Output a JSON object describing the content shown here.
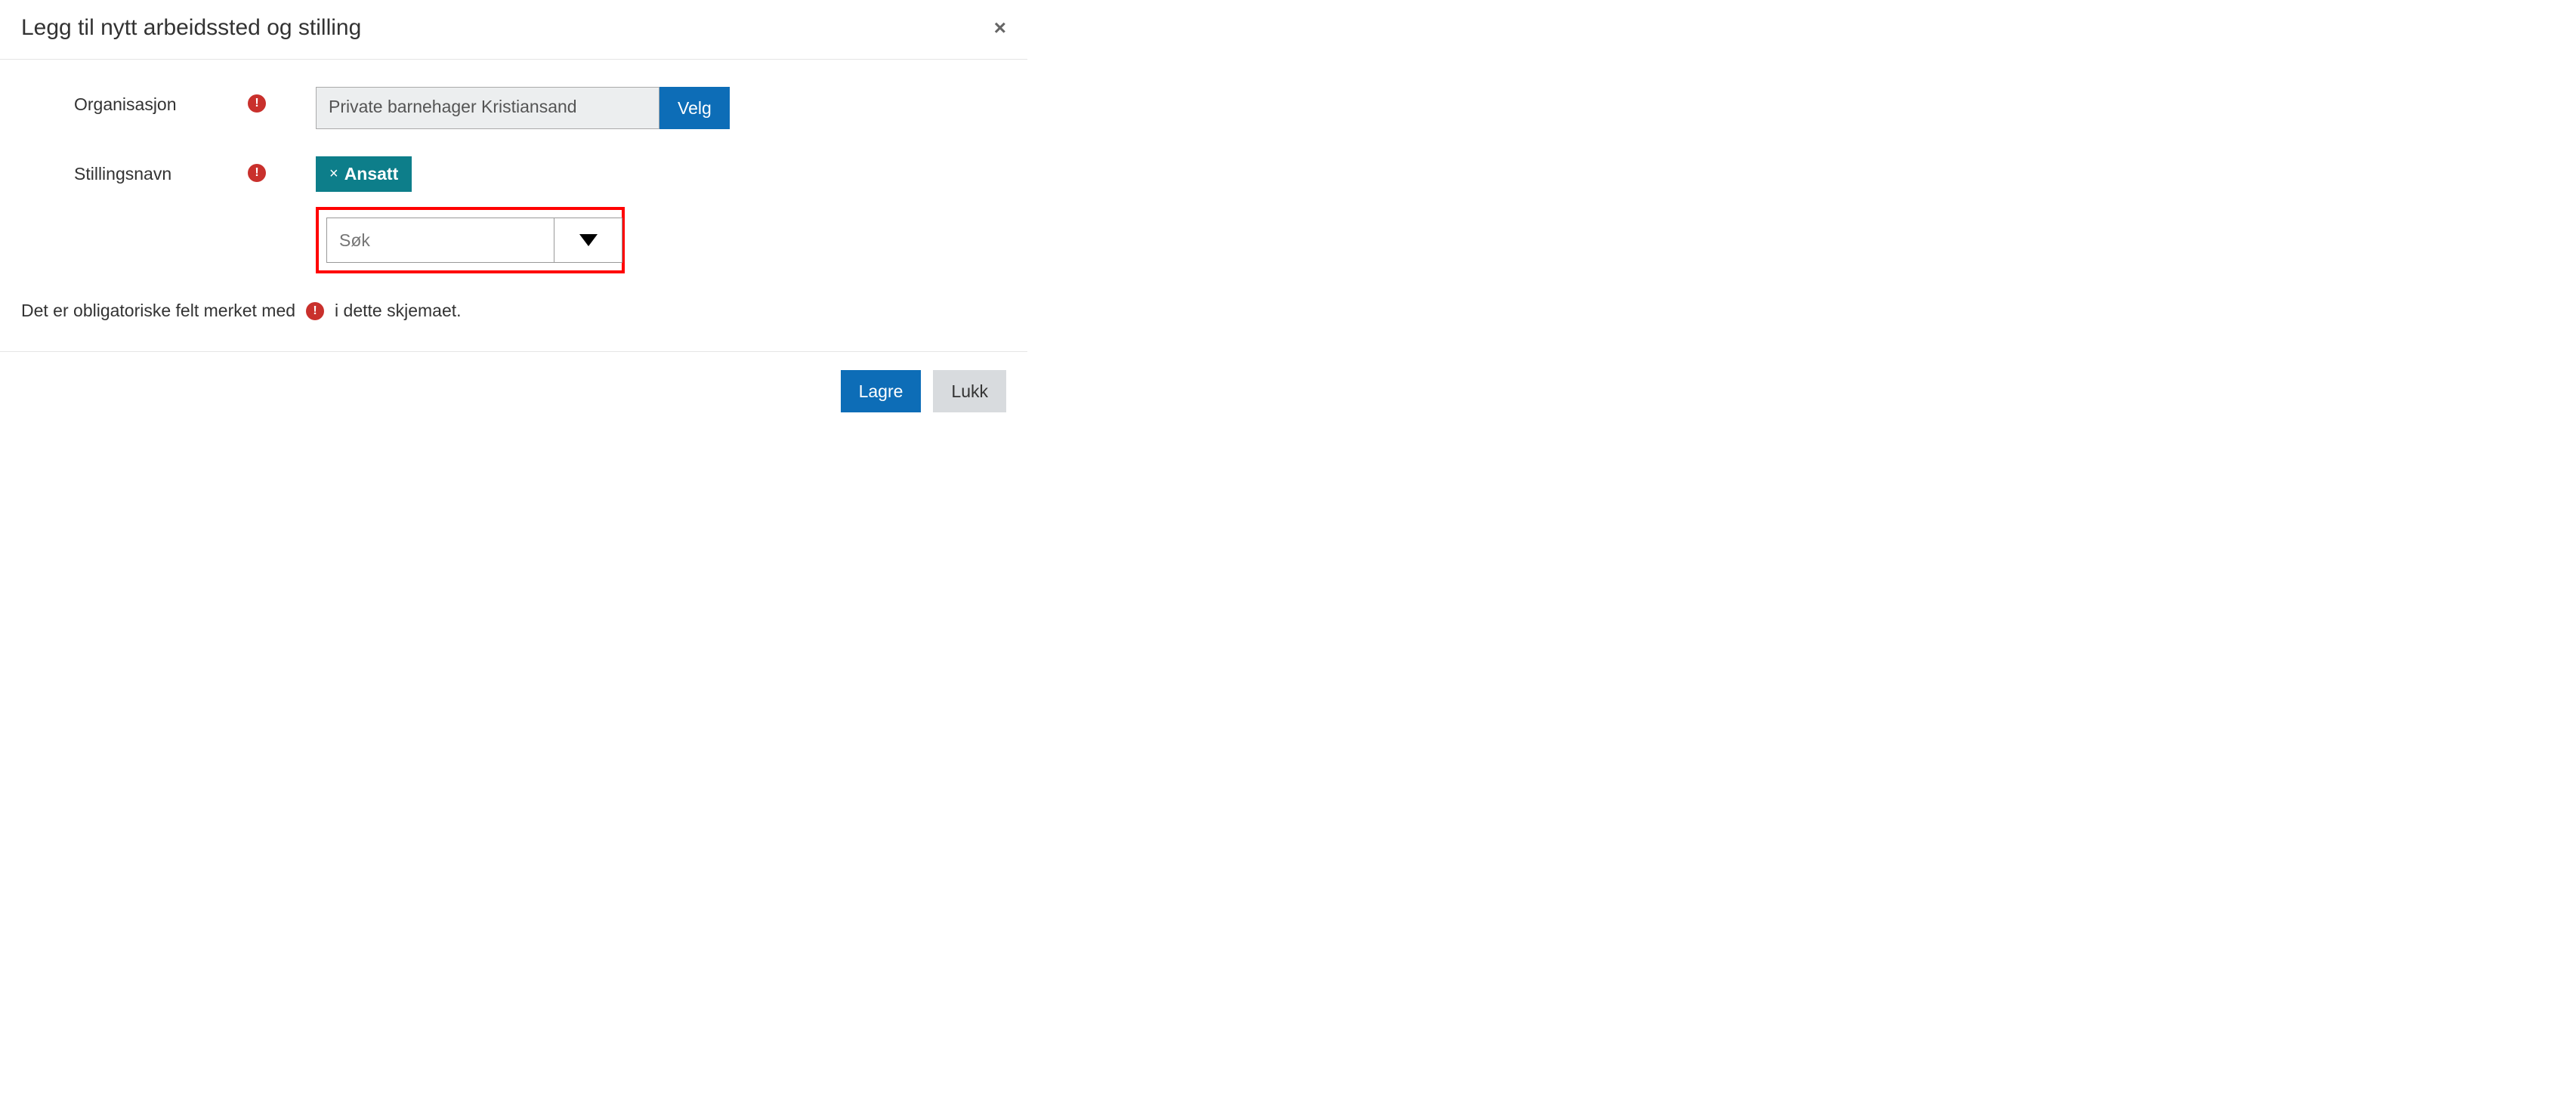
{
  "dialog": {
    "title": "Legg til nytt arbeidssted og stilling"
  },
  "form": {
    "organisasjon": {
      "label": "Organisasjon",
      "value": "Private barnehager Kristiansand",
      "button": "Velg"
    },
    "stillingsnavn": {
      "label": "Stillingsnavn",
      "tag": "Ansatt",
      "tag_remove": "×",
      "search_placeholder": "Søk"
    }
  },
  "note": {
    "prefix": "Det er obligatoriske felt merket med",
    "suffix": "i dette skjemaet."
  },
  "footer": {
    "save": "Lagre",
    "close": "Lukk"
  }
}
